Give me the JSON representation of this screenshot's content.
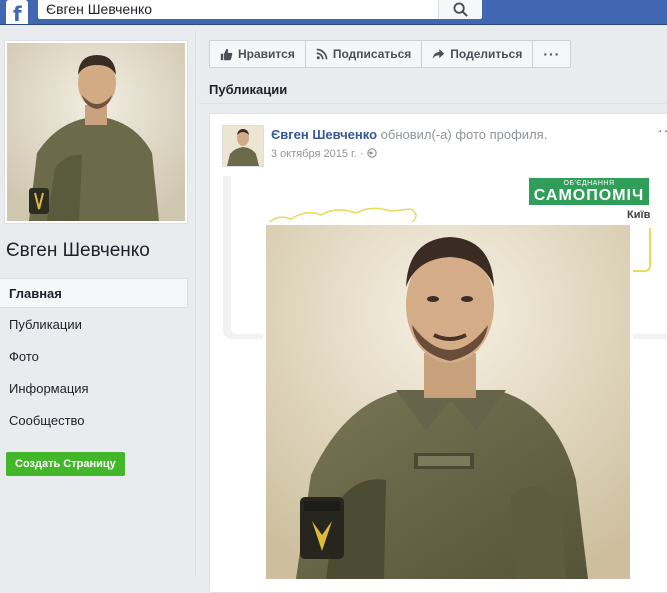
{
  "search": {
    "value": "Євген Шевченко"
  },
  "profile": {
    "name": "Євген Шевченко"
  },
  "nav": {
    "items": [
      {
        "label": "Главная",
        "active": true
      },
      {
        "label": "Публикации"
      },
      {
        "label": "Фото"
      },
      {
        "label": "Информация"
      },
      {
        "label": "Сообщество"
      }
    ],
    "create_page": "Создать Страницу"
  },
  "actions": {
    "like": "Нравится",
    "follow": "Подписаться",
    "share": "Поделиться",
    "more": "···"
  },
  "section_title": "Публикации",
  "post": {
    "author": "Євген Шевченко",
    "action": " обновил(-а) фото профиля.",
    "date": "3 октября 2015 г.",
    "separator": " · ",
    "more": "··"
  },
  "cover": {
    "party_small": "ОБ'ЄДНАННЯ",
    "party_big": "САМОПОМІЧ",
    "city": "Київ"
  },
  "colors": {
    "topbar": "#4267b2",
    "link": "#365899",
    "green_button": "#42b72a",
    "party_green": "#2f9e58"
  },
  "icons": [
    "facebook-logo-icon",
    "search-icon",
    "like-icon",
    "rss-icon",
    "share-arrow-icon",
    "globe-icon"
  ]
}
